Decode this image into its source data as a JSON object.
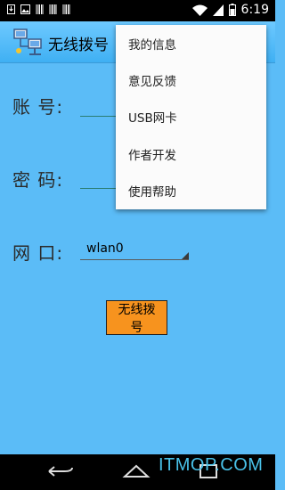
{
  "status_bar": {
    "time": "6:19"
  },
  "app": {
    "title": "无线拨号"
  },
  "form": {
    "account_label": "账 号:",
    "password_label": "密 码:",
    "interface_label": "网 口:",
    "interface_value": "wlan0",
    "dial_button": "无线拨号"
  },
  "menu": {
    "items": [
      {
        "label": "我的信息"
      },
      {
        "label": "意见反馈"
      },
      {
        "label": "USB网卡"
      },
      {
        "label": "作者开发"
      },
      {
        "label": "使用帮助"
      }
    ]
  },
  "watermark": "ITMOP.COM",
  "colors": {
    "background": "#5bbcf7",
    "button": "#f7931e",
    "underline": "#2a7d72"
  }
}
